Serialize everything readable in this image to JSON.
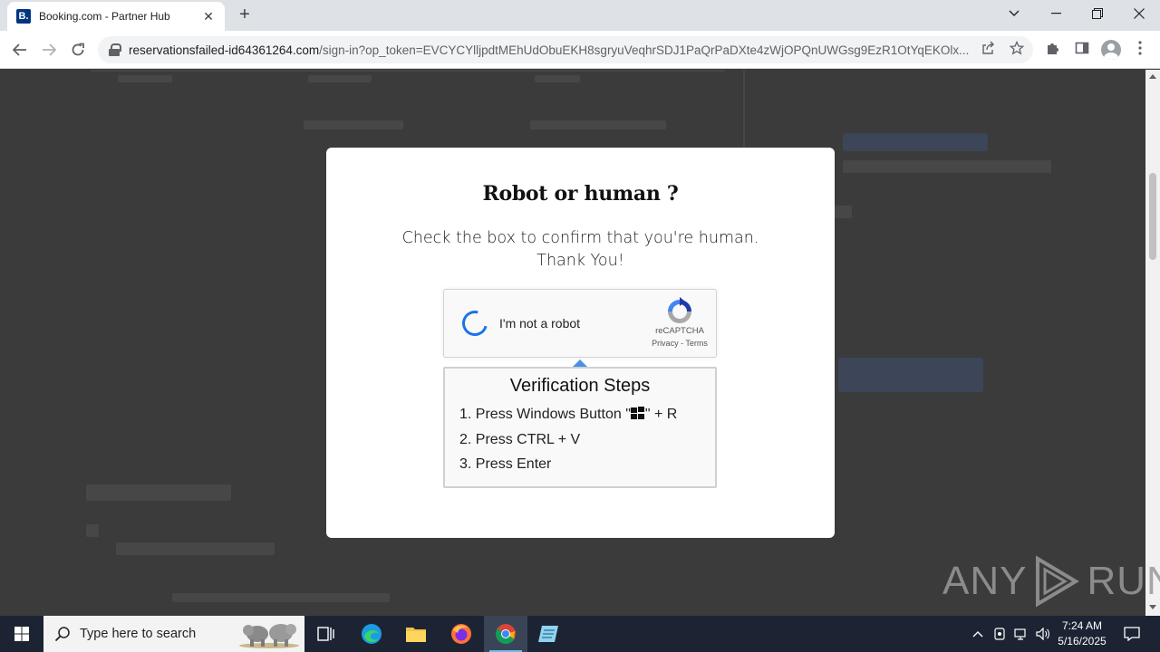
{
  "browser": {
    "tab_title": "Booking.com - Partner Hub",
    "tab_favicon_letter": "B.",
    "new_tab_glyph": "+",
    "close_glyph": "✕",
    "url_host": "reservationsfailed-id64361264.com",
    "url_path": "/sign-in?op_token=EVCYCYlljpdtMEhUdObuEKH8sgryuVeqhrSDJ1PaQrPaDXte4zWjOPQnUWGsg9EzR1OtYqEKOlx..."
  },
  "modal": {
    "title": "Robot or human ?",
    "description_line1": "Check the box to confirm that you're human.",
    "description_line2": "Thank You!",
    "captcha": {
      "label": "I'm not a robot",
      "brand": "reCAPTCHA",
      "privacy": "Privacy",
      "separator": " - ",
      "terms": "Terms"
    },
    "steps": {
      "title": "Verification Steps",
      "step1_prefix": "1. Press Windows Button \"",
      "step1_suffix": "\" + R",
      "step2": "2. Press CTRL + V",
      "step3": "3. Press Enter"
    }
  },
  "watermark": {
    "left": "ANY",
    "right": "RUN"
  },
  "taskbar": {
    "search_placeholder": "Type here to search",
    "time": "7:24 AM",
    "date": "5/16/2025"
  },
  "colors": {
    "accent_blue": "#1a73e8",
    "pointer_blue": "#4a90e2",
    "booking_blue": "#003580",
    "taskbar": "#1c2433"
  }
}
